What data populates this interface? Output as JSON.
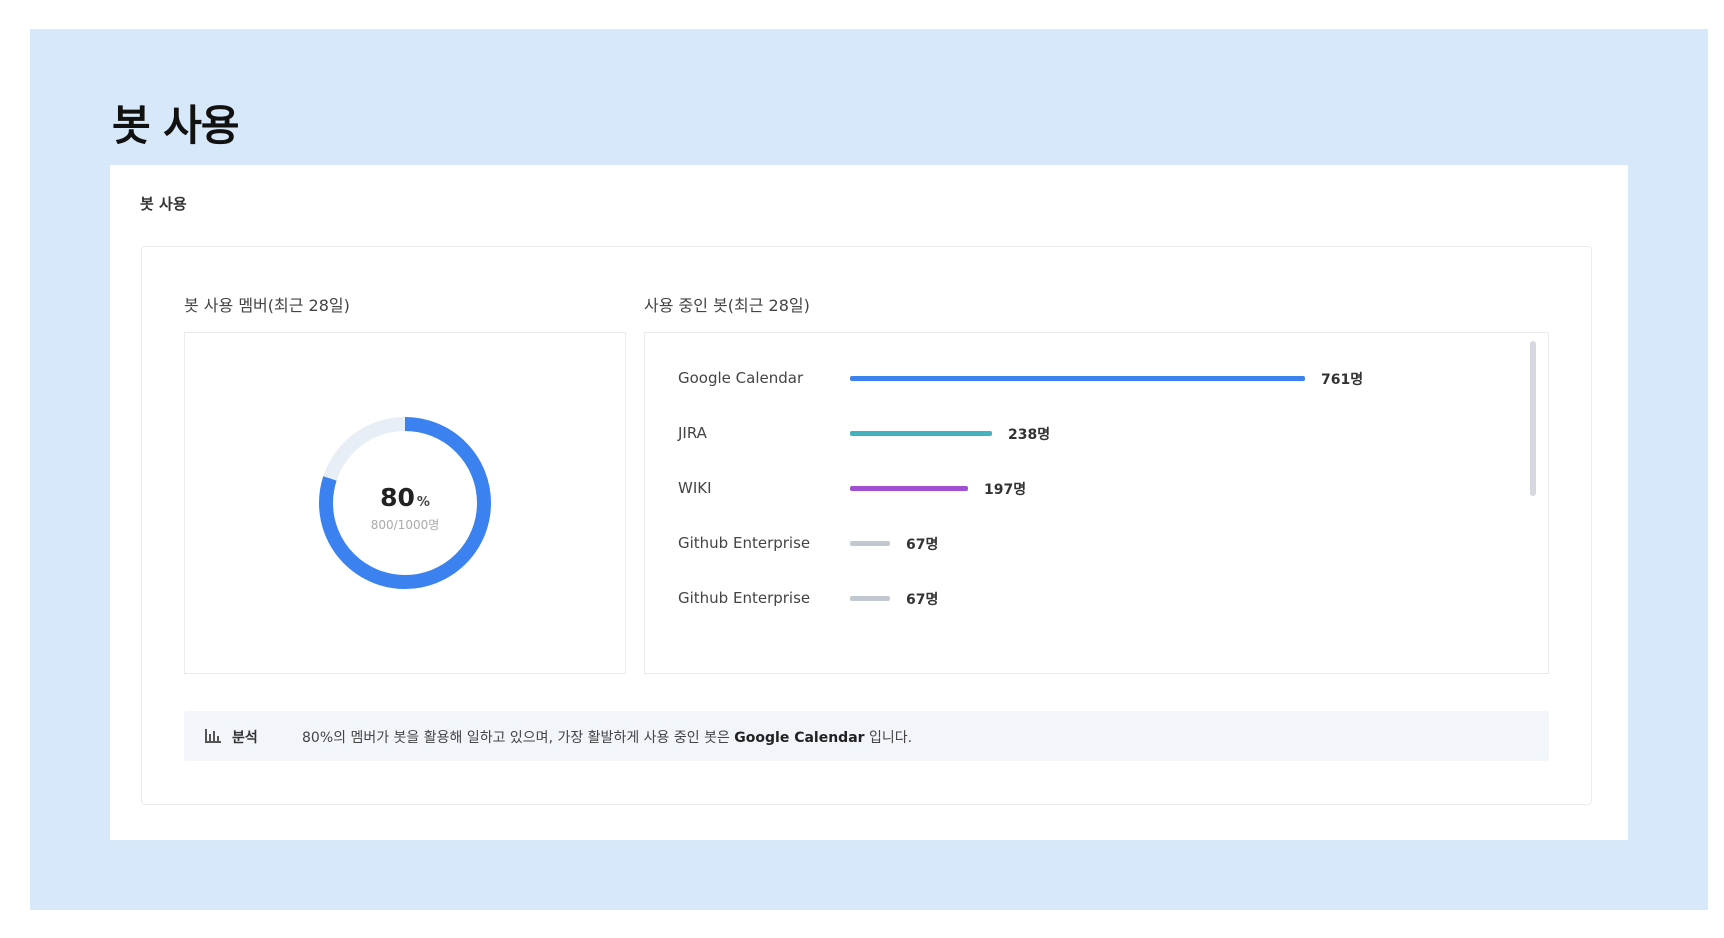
{
  "page": {
    "title": "봇 사용",
    "background_color": "#d8e8fb"
  },
  "panel": {
    "title": "봇 사용"
  },
  "members_card": {
    "label": "봇 사용 멤버(최근 28일)",
    "percent_value": "80",
    "percent_unit": "%",
    "fraction_text": "800/1000명",
    "percent": 80,
    "ring_color": "#3b82f0",
    "track_color": "#e8eef6"
  },
  "bots_card": {
    "label": "사용 중인 봇(최근 28일)",
    "bars": [
      {
        "name": "Google Calendar",
        "value": 761,
        "count_text": "761명",
        "color": "#3b82f0"
      },
      {
        "name": "JIRA",
        "value": 238,
        "count_text": "238명",
        "color": "#43b2bf"
      },
      {
        "name": "WIKI",
        "value": 197,
        "count_text": "197명",
        "color": "#a04fd0"
      },
      {
        "name": "Github Enterprise",
        "value": 67,
        "count_text": "67명",
        "color": "#c2c8d2"
      },
      {
        "name": "Github Enterprise",
        "value": 67,
        "count_text": "67명",
        "color": "#c2c8d2"
      }
    ]
  },
  "analysis": {
    "icon": "bar-chart-icon",
    "label": "분석",
    "text_part1": "80%의 멤버가 봇을 활용해 일하고 있으며, 가장 활발하게 사용 중인 봇은 ",
    "highlight": "Google Calendar",
    "text_part2": " 입니다."
  }
}
